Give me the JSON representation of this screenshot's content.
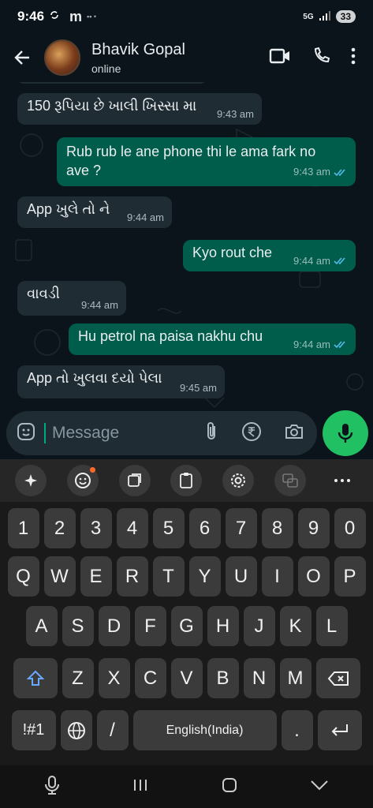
{
  "status_bar": {
    "time": "9:46",
    "carrier_icon": "m",
    "network": "5G",
    "battery": "33"
  },
  "header": {
    "contact_name": "Bhavik Gopal",
    "status": "online"
  },
  "messages": [
    {
      "direction": "in",
      "text": "150 રૂપિયા છે ખાલી ખિસ્સા મા",
      "time": "9:43 am"
    },
    {
      "direction": "out",
      "text_line1": "Rub rub le ane phone thi le ama fark no",
      "text_line2": "ave ?",
      "time": "9:43 am"
    },
    {
      "direction": "in",
      "text": "App ખુલે તો ને",
      "time": "9:44 am"
    },
    {
      "direction": "out",
      "text": "Kyo rout che",
      "time": "9:44 am"
    },
    {
      "direction": "in",
      "text": "વાવડી",
      "time": "9:44 am"
    },
    {
      "direction": "out",
      "text": "Hu petrol na paisa nakhu chu",
      "time": "9:44 am"
    },
    {
      "direction": "in",
      "text": "App તો ખુલવા દયો પેલા",
      "time": "9:45 am"
    }
  ],
  "composer": {
    "placeholder": "Message"
  },
  "keyboard": {
    "number_row": [
      "1",
      "2",
      "3",
      "4",
      "5",
      "6",
      "7",
      "8",
      "9",
      "0"
    ],
    "row1": [
      "Q",
      "W",
      "E",
      "R",
      "T",
      "Y",
      "U",
      "I",
      "O",
      "P"
    ],
    "row2": [
      "A",
      "S",
      "D",
      "F",
      "G",
      "H",
      "J",
      "K",
      "L"
    ],
    "row3": [
      "Z",
      "X",
      "C",
      "V",
      "B",
      "N",
      "M"
    ],
    "symbols_label": "!#1",
    "slash_label": "/",
    "space_label": "English(India)",
    "period_label": "."
  },
  "colors": {
    "incoming_bubble": "#202c33",
    "outgoing_bubble": "#005c4b",
    "accent": "#21c063",
    "read_ticks": "#53bdeb"
  }
}
